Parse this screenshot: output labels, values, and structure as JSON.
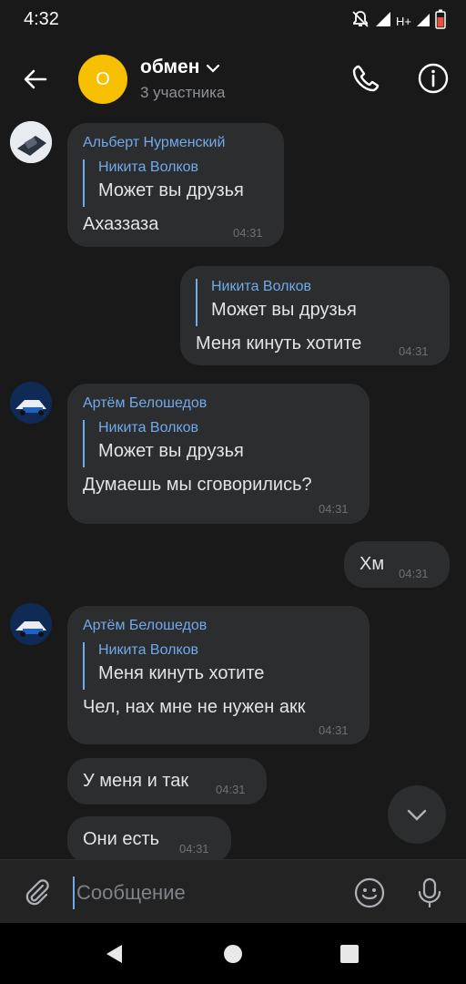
{
  "status_bar": {
    "time": "4:32",
    "network": "H+",
    "icons": [
      "bell-off-icon",
      "signal-icon",
      "battery-icon"
    ]
  },
  "header": {
    "avatar_letter": "О",
    "avatar_color": "#f6c000",
    "title": "обмен",
    "subtitle": "3 участника",
    "icons": [
      "back-arrow-icon",
      "chevron-down-icon",
      "phone-icon",
      "info-icon"
    ]
  },
  "messages": [
    {
      "direction": "incoming",
      "sender": "Альберт Нурменский",
      "quote": {
        "name": "Никита Волков",
        "text": "Может вы друзья"
      },
      "text": "Ахаззаза",
      "time": "04:31"
    },
    {
      "direction": "outgoing",
      "quote": {
        "name": "Никита Волков",
        "text": "Может вы друзья"
      },
      "text": "Меня кинуть хотите",
      "time": "04:31"
    },
    {
      "direction": "incoming",
      "sender": "Артём Белошедов",
      "quote": {
        "name": "Никита Волков",
        "text": "Может вы друзья"
      },
      "text": "Думаешь мы сговорились?",
      "time": "04:31"
    },
    {
      "direction": "outgoing",
      "text": "Хм",
      "time": "04:31"
    },
    {
      "direction": "incoming",
      "sender": "Артём Белошедов",
      "quote": {
        "name": "Никита Волков",
        "text": "Меня кинуть хотите"
      },
      "text": "Чел, нах мне не нужен акк",
      "time": "04:31"
    },
    {
      "direction": "incoming",
      "text": "У меня и так",
      "time": "04:31"
    },
    {
      "direction": "incoming",
      "text": "Они есть",
      "time": "04:31"
    }
  ],
  "composer": {
    "placeholder": "Сообщение",
    "value": "",
    "icons": [
      "attach-icon",
      "emoji-icon",
      "microphone-icon"
    ]
  },
  "navigation": {
    "icons": [
      "nav-back-icon",
      "nav-home-icon",
      "nav-recents-icon"
    ]
  },
  "colors": {
    "background": "#19191a",
    "bubble": "#2c2d2e",
    "accent": "#71aaeb",
    "text": "#e1e3e6",
    "secondary": "#6d7175"
  }
}
